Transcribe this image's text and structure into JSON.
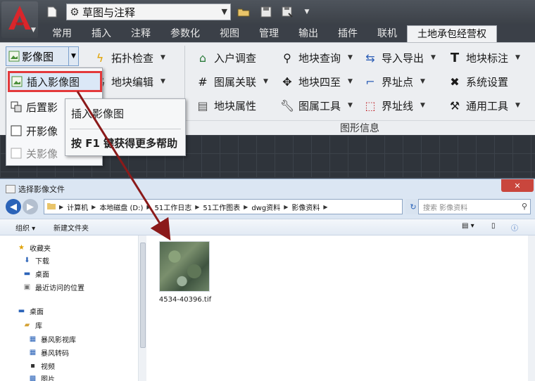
{
  "cad": {
    "app_logo": "autocad-logo-icon",
    "workspace": {
      "label": "草图与注释"
    },
    "qat": [
      "new-icon",
      "open-icon",
      "save-icon",
      "saveas-icon",
      "dropdown-icon"
    ],
    "tabs": [
      {
        "label": "常用"
      },
      {
        "label": "插入"
      },
      {
        "label": "注释"
      },
      {
        "label": "参数化"
      },
      {
        "label": "视图"
      },
      {
        "label": "管理"
      },
      {
        "label": "输出"
      },
      {
        "label": "插件"
      },
      {
        "label": "联机"
      },
      {
        "label": "土地承包经营权"
      }
    ],
    "active_tab": "土地承包经营权",
    "left_group": {
      "image_button": "影像图",
      "topology_check": "拓扑检查",
      "parcel_edit": "地块编辑"
    },
    "menu": {
      "items": [
        {
          "label": "插入影像图",
          "icon": "insert-image-icon"
        },
        {
          "label": "后置影",
          "icon": "back-order-icon"
        },
        {
          "label": "开影像",
          "icon": "open-image-icon"
        },
        {
          "label": "关影像",
          "icon": "close-image-icon"
        }
      ]
    },
    "tooltip": {
      "title": "插入影像图",
      "help_prefix": "按 F1 键获得更多帮助"
    },
    "ribbon": {
      "col1": [
        "入户调查",
        "图属关联",
        "地块属性"
      ],
      "col2": [
        "地块查询",
        "地块四至",
        "图属工具"
      ],
      "col3": [
        "导入导出",
        "界址点",
        "界址线"
      ],
      "col4": [
        "地块标注",
        "系统设置",
        "通用工具"
      ],
      "group_label": "图形信息"
    }
  },
  "dialog": {
    "title": "选择影像文件",
    "breadcrumb": [
      "计算机",
      "本地磁盘 (D:)",
      "51工作日志",
      "51工作图表",
      "dwg资料",
      "影像资料"
    ],
    "search_placeholder": "搜索 影像资料",
    "toolbar": {
      "organize": "组织 ▾",
      "new_folder": "新建文件夹"
    },
    "nav": {
      "favorites": "收藏夹",
      "downloads": "下载",
      "desktop_fav": "桌面",
      "recent": "最近访问的位置",
      "desktop": "桌面",
      "library": "库",
      "lib_items": [
        "暴风影视库",
        "暴风转码",
        "视频",
        "图片"
      ]
    },
    "files": [
      {
        "name": "4534-40396.tif",
        "icon": "satellite-thumbnail"
      }
    ]
  },
  "colors": {
    "highlight_border": "#e3393b",
    "arrow": "#8b1a1a",
    "ribbon_bg": "#eceef1",
    "dialog_bg": "#dbe6f3"
  }
}
